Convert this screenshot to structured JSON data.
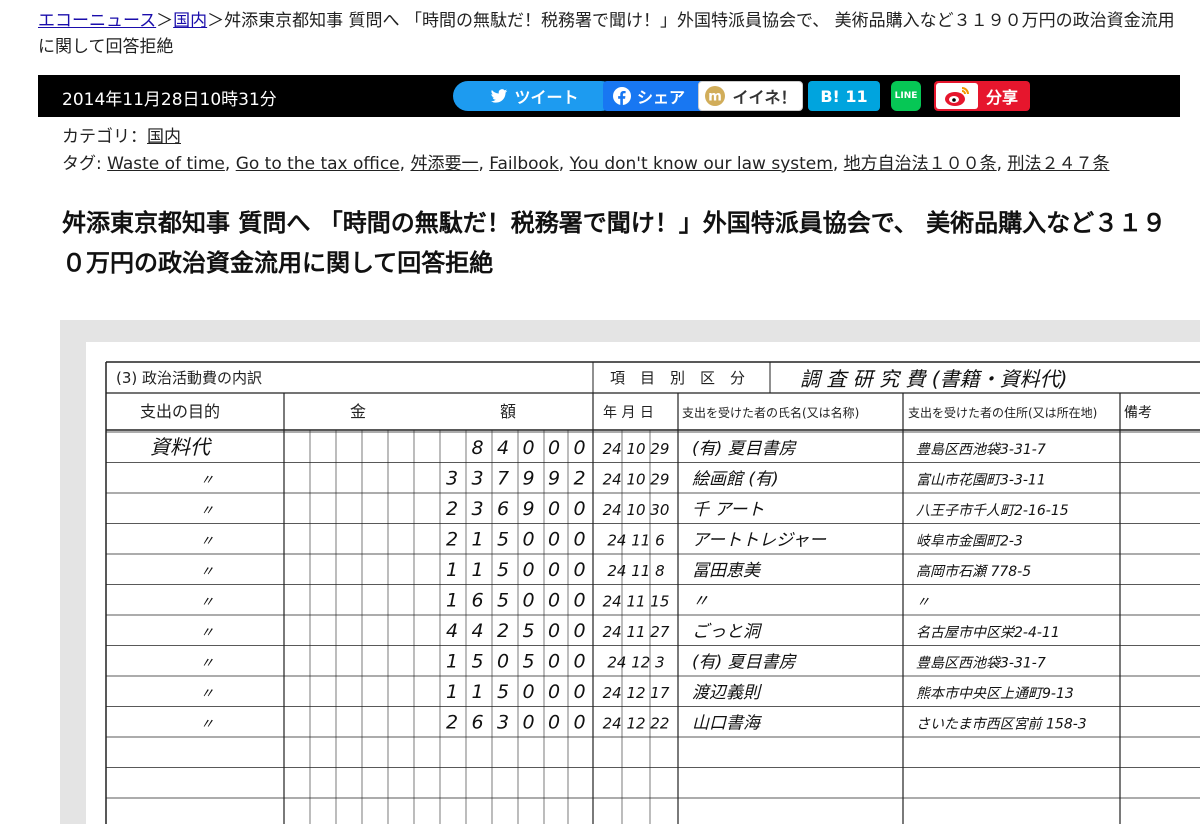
{
  "breadcrumb": {
    "home": "エコーニュース",
    "sep1": "＞",
    "category": "国内",
    "sep2": "＞",
    "current": "舛添東京都知事 質問へ 「時間の無駄だ！税務署で聞け！」外国特派員協会で、 美術品購入など３１９０万円の政治資金流用に関して回答拒絶"
  },
  "bar": {
    "date": "2014年11月28日10時31分",
    "tweet": "ツイート",
    "facebook": "シェア",
    "mixi": "イイネ！",
    "hatena": "B! 11",
    "line": "LINE",
    "weibo": "分享",
    "colors": {
      "twitter": "#1d9bf0",
      "facebook": "#1877f2",
      "hatena": "#00a4de",
      "line": "#06c755",
      "weibo": "#e6162d"
    }
  },
  "meta": {
    "category_label": "カテゴリ：",
    "category": "国内",
    "tags_label": "タグ: ",
    "tags": [
      "Waste of time",
      "Go to the tax office",
      "舛添要一",
      "Failbook",
      "You don't know our law system",
      "地方自治法１００条",
      "刑法２４７条"
    ]
  },
  "article": {
    "title": "舛添東京都知事 質問へ 「時間の無駄だ！税務署で聞け！」外国特派員協会で、 美術品購入など３１９０万円の政治資金流用に関して回答拒絶"
  },
  "document": {
    "section": "(3)  政治活動費の内訳",
    "category_label": "項　目　別　区　分",
    "category_value": "調 査 研 究 費  (書籍・資料代)",
    "headers": {
      "purpose": "支出の目的",
      "amount_1": "金",
      "amount_2": "額",
      "date": "年 月 日",
      "payee_name": "支出を受けた者の氏名(又は名称)",
      "payee_address": "支出を受けた者の住所(又は所在地)",
      "notes": "備考"
    },
    "rows": [
      {
        "purpose": "資料代",
        "amount": "84000",
        "date": "24 10 29",
        "name": "(有) 夏目書房",
        "address": "豊島区西池袋3-31-7"
      },
      {
        "purpose": "〃",
        "amount": "337992",
        "date": "24 10 29",
        "name": "絵画館 (有)",
        "address": "富山市花園町3-3-11"
      },
      {
        "purpose": "〃",
        "amount": "236900",
        "date": "24 10 30",
        "name": "千 アート",
        "address": "八王子市千人町2-16-15"
      },
      {
        "purpose": "〃",
        "amount": "215000",
        "date": "24 11 6",
        "name": "アートトレジャー",
        "address": "岐阜市金園町2-3"
      },
      {
        "purpose": "〃",
        "amount": "115000",
        "date": "24 11 8",
        "name": "冨田恵美",
        "address": "高岡市石瀬 778-5"
      },
      {
        "purpose": "〃",
        "amount": "165000",
        "date": "24 11 15",
        "name": "〃",
        "address": "〃"
      },
      {
        "purpose": "〃",
        "amount": "442500",
        "date": "24 11 27",
        "name": "ごっと洞",
        "address": "名古屋市中区栄2-4-11"
      },
      {
        "purpose": "〃",
        "amount": "150500",
        "date": "24 12 3",
        "name": "(有) 夏目書房",
        "address": "豊島区西池袋3-31-7"
      },
      {
        "purpose": "〃",
        "amount": "115000",
        "date": "24 12 17",
        "name": "渡辺義則",
        "address": "熊本市中央区上通町9-13"
      },
      {
        "purpose": "〃",
        "amount": "263000",
        "date": "24 12 22",
        "name": "山口書海",
        "address": "さいたま市西区宮前 158-3"
      }
    ]
  }
}
